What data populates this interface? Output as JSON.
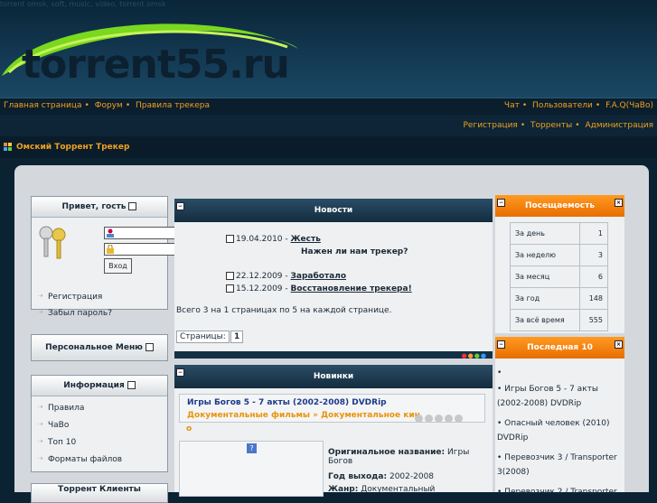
{
  "top_text": "torrent omsk, soft, music, video, torrent omsk",
  "logo": {
    "text": "torrent55.ru"
  },
  "nav_left": [
    {
      "label": "Главная страница"
    },
    {
      "label": "Форум"
    },
    {
      "label": "Правила трекера"
    }
  ],
  "nav_right": [
    {
      "label": "Чат"
    },
    {
      "label": "Пользователи"
    },
    {
      "label": "F.A.Q(ЧаВо)"
    }
  ],
  "nav2_right": [
    {
      "label": "Регистрация"
    },
    {
      "label": "Торренты"
    },
    {
      "label": "Администрация"
    }
  ],
  "site_title": "Омский Торрент Трекер",
  "login_box": {
    "title": "Привет, гость",
    "button": "Вход",
    "links": [
      {
        "label": "Регистрация"
      },
      {
        "label": "Забыл пароль?"
      }
    ]
  },
  "personal_menu": {
    "title": "Персональное Меню"
  },
  "info_box": {
    "title": "Информация",
    "links": [
      {
        "label": "Правила"
      },
      {
        "label": "ЧаВо"
      },
      {
        "label": "Топ 10"
      },
      {
        "label": "Форматы файлов"
      }
    ]
  },
  "clients_box": {
    "title": "Торрент Клиенты"
  },
  "news": {
    "title": "Новости",
    "items": [
      {
        "date": "19.04.2010",
        "title": "Жесть",
        "body": "Нажен ли нам трекер?"
      },
      {
        "date": "22.12.2009",
        "title": "Заработало",
        "body": ""
      },
      {
        "date": "15.12.2009",
        "title": "Восстановление трекера!",
        "body": ""
      }
    ],
    "summary": "Всего 3 на 1 страницах по 5 на каждой странице.",
    "pages_label": "Страницы:",
    "page": "1"
  },
  "new_box": {
    "title": "Новинки",
    "item_title": "Игры Богов 5 - 7 акты (2002-2008) DVDRip",
    "cat1": "Документальные фильмы",
    "cat2": "Документальное кин",
    "cat2b": "о",
    "orig_label": "Оригинальное название:",
    "orig_value": "Игры Богов",
    "year_label": "Год выхода:",
    "year_value": "2002-2008",
    "genre_label": "Жанр:",
    "genre_value": "Документальный"
  },
  "visits": {
    "title": "Посещаемость",
    "rows": [
      {
        "label": "За день",
        "value": "1"
      },
      {
        "label": "За неделю",
        "value": "3"
      },
      {
        "label": "За месяц",
        "value": "6"
      },
      {
        "label": "За год",
        "value": "148"
      },
      {
        "label": "За всё время",
        "value": "555"
      }
    ]
  },
  "last10": {
    "title": "Последная 10",
    "items": [
      {
        "label": ""
      },
      {
        "label": "Игры Богов 5 - 7 акты (2002-2008) DVDRip"
      },
      {
        "label": "Опасный человек (2010) DVDRip"
      },
      {
        "label": "Перевозчик 3 / Transporter 3(2008)"
      },
      {
        "label": "Перевозчик 2 / Transporter"
      }
    ]
  },
  "colors": {
    "accent": "#f0a020",
    "header_dark": "#142c3e",
    "orange": "#ff9a22"
  }
}
